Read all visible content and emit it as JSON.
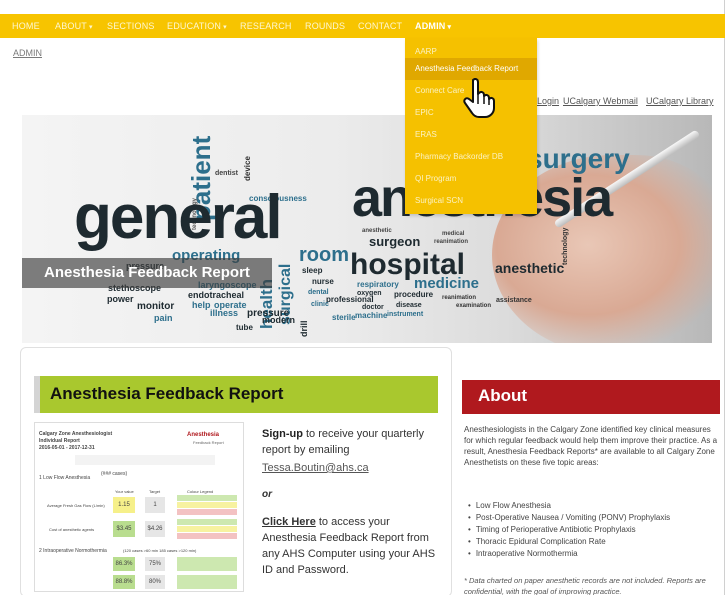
{
  "nav": {
    "items": [
      {
        "label": "HOME",
        "has_caret": false
      },
      {
        "label": "ABOUT",
        "has_caret": true
      },
      {
        "label": "SECTIONS",
        "has_caret": false
      },
      {
        "label": "EDUCATION",
        "has_caret": true
      },
      {
        "label": "RESEARCH",
        "has_caret": false
      },
      {
        "label": "ROUNDS",
        "has_caret": false
      },
      {
        "label": "CONTACT",
        "has_caret": false
      },
      {
        "label": "ADMIN",
        "has_caret": true
      }
    ],
    "bar_color": "#f7c400"
  },
  "breadcrumb": "ADMIN",
  "admin_dropdown": {
    "items": [
      "AARP",
      "Anesthesia Feedback Report",
      "Connect Care",
      "EPIC",
      "ERAS",
      "Pharmacy Backorder DB",
      "QI Program",
      "Surgical SCN"
    ],
    "hovered": "Anesthesia Feedback Report"
  },
  "utility_links": [
    "Login",
    "UCalgary Webmail",
    "UCalgary Library"
  ],
  "banner": {
    "title": "Anesthesia Feedback Report",
    "word_cloud": [
      "general",
      "anesthesia",
      "patient",
      "surgery",
      "hospital",
      "operating",
      "room",
      "medicine",
      "surgeon",
      "stethoscope",
      "pressure",
      "power",
      "monitor",
      "health",
      "surgical",
      "endotracheal",
      "laryngoscope",
      "pain",
      "tube",
      "illness",
      "help",
      "operate",
      "modern",
      "drill",
      "push",
      "therapy",
      "dentist",
      "device",
      "consciousness",
      "technology",
      "professional",
      "procedure",
      "respiratory",
      "nurse",
      "sleep",
      "oxygen",
      "sterile",
      "machine",
      "instrument",
      "doctor",
      "disease",
      "assistance",
      "examination",
      "reanimation",
      "medical",
      "anesthetic",
      "dental",
      "clinic"
    ]
  },
  "feedback": {
    "heading": "Anesthesia Feedback Report",
    "signup_bold": "Sign-up",
    "signup_rest": "to receive your quarterly report by emailing",
    "email": "Tessa.Boutin@ahs.ca",
    "or": "or",
    "click_here": "Click Here",
    "click_rest": "to access your Anesthesia Feedback Report from any AHS Computer using your AHS ID and Password."
  },
  "report_thumb": {
    "title1": "Calgary Zone Anesthesiologist",
    "title2": "Individual Report",
    "dates": "2016-05-01 - 2017-12-31",
    "logo": "Anesthesia",
    "logo_sub": "Feedback Report",
    "sec1": "1   Low Flow Anesthesia",
    "sec1_cases": "(### cases)",
    "col_you": "Your value",
    "col_target": "Target",
    "col_legend": "Colour Legend",
    "row1": "Average Fresh Gas Flow (L/min)",
    "row1_val": "1.15",
    "row1_target": "1",
    "row2": "Cost of anesthetic agents",
    "row2_val": "$3.45",
    "row2_target": "$4.26",
    "sec2": "2   Intraoperative Normothermia",
    "sec2_cases": "(120 cases >60 min 185 cases >120 min)",
    "row3_val": "86.3%",
    "row3_target": "75%",
    "row4_val": "88.8%",
    "row4_target": "80%"
  },
  "about": {
    "heading": "About",
    "body": "Anesthesiologists in the Calgary Zone identified key clinical measures for which regular feedback would help them improve their practice. As a result, Anesthesia Feedback Reports* are available to all Calgary Zone Anesthetists on these five topic areas:",
    "topics": [
      "Low Flow Anesthesia",
      "Post-Operative Nausea / Vomiting (PONV) Prophylaxis",
      "Timing of Perioperative Antibiotic Prophylaxis",
      "Thoracic Epidural Complication Rate",
      "Intraoperative Normothermia"
    ],
    "note": "* Data charted on paper anesthetic records are not included. Reports are confidential, with the goal of improving practice."
  },
  "colors": {
    "accent_yellow": "#f7c400",
    "feedback_green": "#a9c82e",
    "about_red": "#b0191e"
  }
}
